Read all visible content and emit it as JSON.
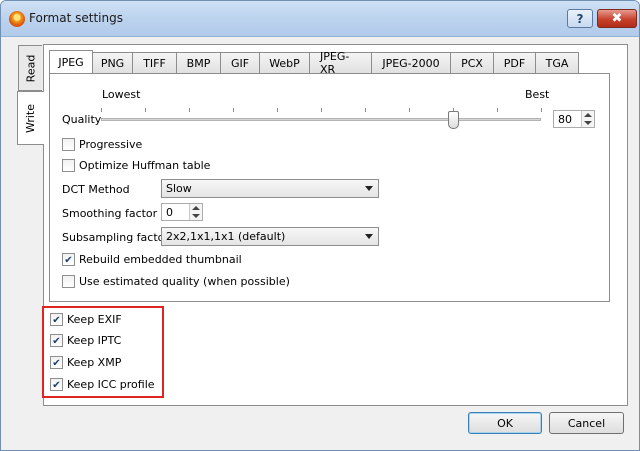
{
  "window": {
    "title": "Format settings",
    "help_label": "?",
    "close_label": "✖"
  },
  "side_tabs": {
    "read": "Read",
    "write": "Write"
  },
  "format_tabs": [
    "JPEG",
    "PNG",
    "TIFF",
    "BMP",
    "GIF",
    "WebP",
    "JPEG-XR",
    "JPEG-2000",
    "PCX",
    "PDF",
    "TGA"
  ],
  "active_format_tab": "JPEG",
  "jpeg": {
    "quality_label": "Quality",
    "quality_min_label": "Lowest",
    "quality_max_label": "Best",
    "quality_value": "80",
    "quality_fraction": 0.8,
    "progressive": {
      "label": "Progressive",
      "checked": false
    },
    "optimize_huffman": {
      "label": "Optimize Huffman table",
      "checked": false
    },
    "dct_method": {
      "label": "DCT Method",
      "value": "Slow"
    },
    "smoothing": {
      "label": "Smoothing factor",
      "value": "0"
    },
    "subsampling": {
      "label": "Subsampling factor",
      "value": "2x2,1x1,1x1 (default)"
    },
    "rebuild_thumbnail": {
      "label": "Rebuild embedded thumbnail",
      "checked": true
    },
    "estimated_quality": {
      "label": "Use estimated quality (when possible)",
      "checked": false
    }
  },
  "metadata": {
    "keep_exif": {
      "label": "Keep EXIF",
      "checked": true
    },
    "keep_iptc": {
      "label": "Keep IPTC",
      "checked": true
    },
    "keep_xmp": {
      "label": "Keep XMP",
      "checked": true
    },
    "keep_icc": {
      "label": "Keep ICC profile",
      "checked": true
    }
  },
  "buttons": {
    "ok": "OK",
    "cancel": "Cancel"
  },
  "colors": {
    "highlight_frame": "#e02424",
    "titlebar": "#bcd3ee"
  }
}
